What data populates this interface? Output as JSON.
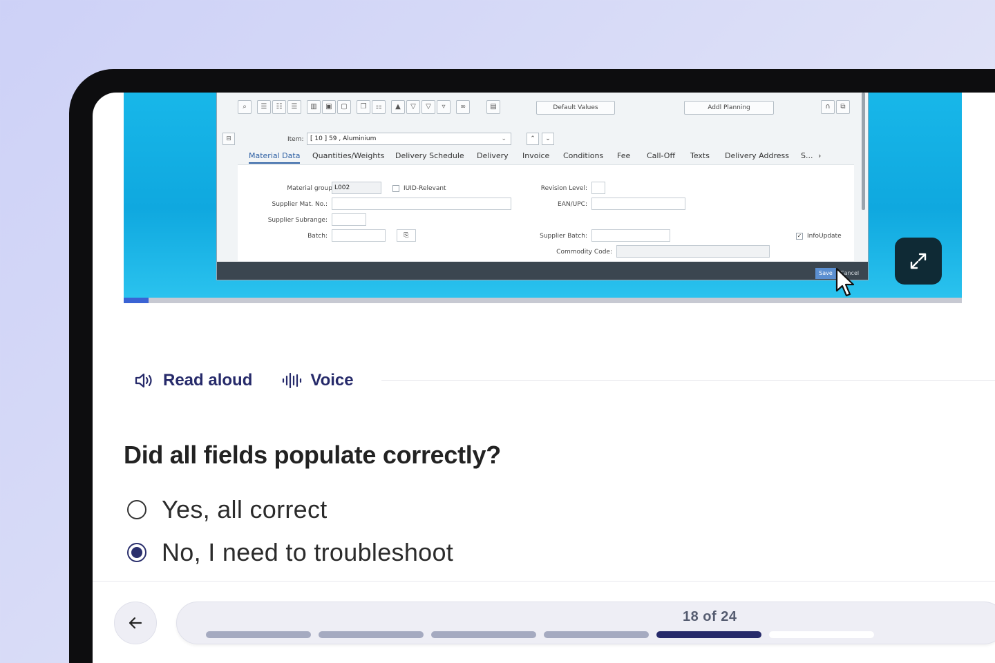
{
  "video": {
    "progress_fraction": 0.03,
    "sap": {
      "toolbar_default_values": "Default Values",
      "toolbar_addl_planning": "Addl Planning",
      "item_label": "Item:",
      "item_value": "[ 10 ] 59 , Aluminium",
      "tabs": [
        "Material Data",
        "Quantities/Weights",
        "Delivery Schedule",
        "Delivery",
        "Invoice",
        "Conditions",
        "Fee",
        "Call-Off",
        "Texts",
        "Delivery Address",
        "S..."
      ],
      "fields": {
        "material_group_label": "Material group:",
        "material_group_value": "L002",
        "iuid_label": "IUID-Relevant",
        "revision_level_label": "Revision Level:",
        "supplier_mat_no_label": "Supplier Mat. No.:",
        "ean_upc_label": "EAN/UPC:",
        "supplier_subrange_label": "Supplier Subrange:",
        "batch_label": "Batch:",
        "supplier_batch_label": "Supplier Batch:",
        "info_update_label": "InfoUpdate",
        "commodity_code_label": "Commodity Code:"
      },
      "save_label": "Save",
      "cancel_label": "Cancel"
    }
  },
  "controls": {
    "read_aloud": "Read aloud",
    "voice": "Voice"
  },
  "question": {
    "text": "Did all fields populate correctly?",
    "options": [
      {
        "label": "Yes, all correct",
        "selected": false
      },
      {
        "label": "No, I need to troubleshoot",
        "selected": true
      }
    ]
  },
  "progress": {
    "text": "18 of 24",
    "current": 18,
    "total": 24
  },
  "colors": {
    "accent": "#262a6a",
    "video_bg": "#18b7e9",
    "expand_button_bg": "#0f2a35"
  }
}
